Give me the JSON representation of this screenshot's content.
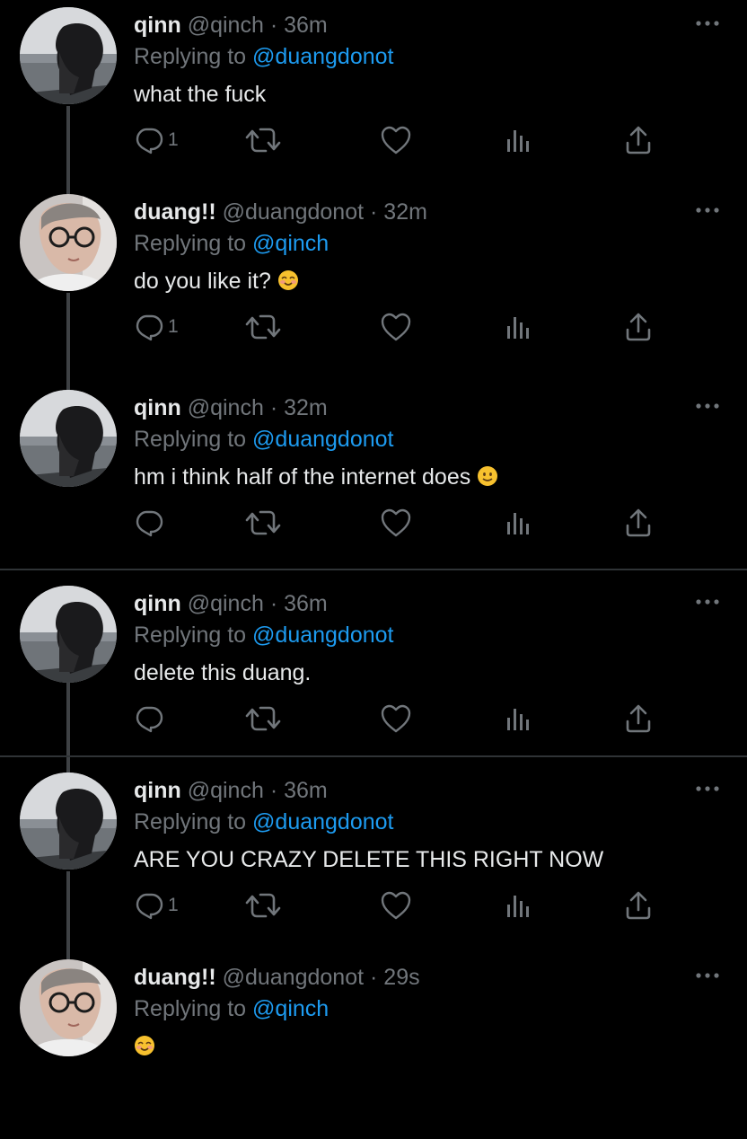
{
  "tweets": [
    {
      "name": "qinn",
      "handle": "@qinch",
      "time": "36m",
      "reply_prefix": "Replying to",
      "reply_to": "@duangdonot",
      "text": "what the fuck",
      "reply_count": "1",
      "emoji": "",
      "avatar": "qinn"
    },
    {
      "name": "duang!!",
      "handle": "@duangdonot",
      "time": "32m",
      "reply_prefix": "Replying to",
      "reply_to": "@qinch",
      "text": "do you like it?",
      "reply_count": "1",
      "emoji": "smiling-blush",
      "avatar": "duang"
    },
    {
      "name": "qinn",
      "handle": "@qinch",
      "time": "32m",
      "reply_prefix": "Replying to",
      "reply_to": "@duangdonot",
      "text": "hm i think half of the internet does",
      "reply_count": "",
      "emoji": "slight-smile",
      "avatar": "qinn"
    },
    {
      "name": "qinn",
      "handle": "@qinch",
      "time": "36m",
      "reply_prefix": "Replying to",
      "reply_to": "@duangdonot",
      "text": "delete this duang.",
      "reply_count": "",
      "emoji": "",
      "avatar": "qinn"
    },
    {
      "name": "qinn",
      "handle": "@qinch",
      "time": "36m",
      "reply_prefix": "Replying to",
      "reply_to": "@duangdonot",
      "text": "ARE YOU CRAZY DELETE THIS RIGHT NOW",
      "reply_count": "1",
      "emoji": "",
      "avatar": "qinn"
    },
    {
      "name": "duang!!",
      "handle": "@duangdonot",
      "time": "29s",
      "reply_prefix": "Replying to",
      "reply_to": "@qinch",
      "text": "",
      "reply_count": "",
      "emoji": "smiling-blush",
      "avatar": "duang"
    }
  ],
  "separator": "·",
  "icons": [
    "reply-icon",
    "retweet-icon",
    "like-icon",
    "analytics-icon",
    "share-icon",
    "more-icon"
  ],
  "colors": {
    "background": "#000000",
    "text": "#e7e9ea",
    "muted": "#71767b",
    "link": "#1d9bf0",
    "thread_line": "#3e4144",
    "divider": "#2f3336"
  }
}
